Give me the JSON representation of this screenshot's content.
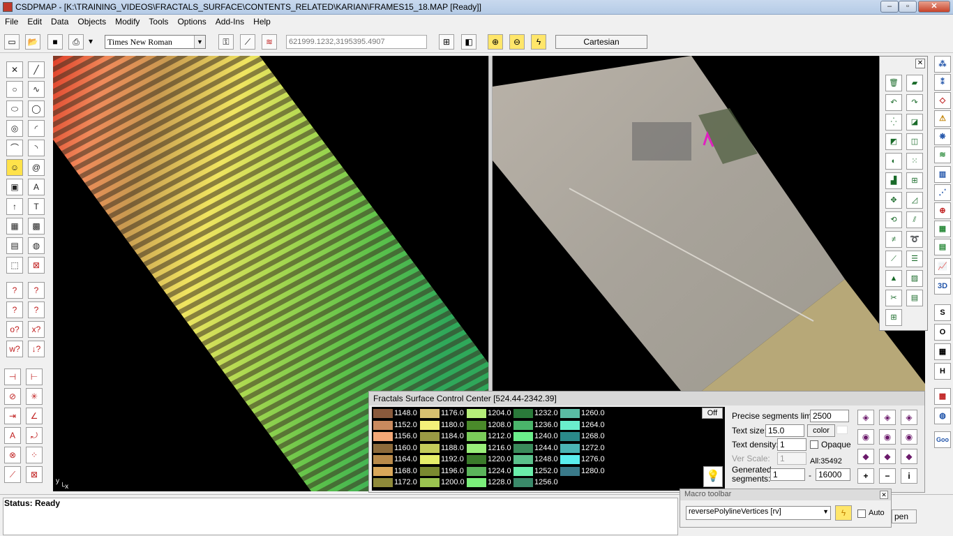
{
  "window": {
    "title": "CSDPMAP - [K:\\TRAINING_VIDEOS\\FRACTALS_SURFACE\\CONTENTS_RELATED\\KARIAN\\FRAMES15_18.MAP [Ready]]",
    "minimize": "–",
    "maximize": "▫",
    "close": "✕"
  },
  "menu": [
    "File",
    "Edit",
    "Data",
    "Objects",
    "Modify",
    "Tools",
    "Options",
    "Add-Ins",
    "Help"
  ],
  "toolbar": {
    "font": "Times New Roman",
    "coords": "621999.1232,3195395.4907",
    "mode": "Cartesian"
  },
  "viewport": {
    "axis_label": "y\n1x"
  },
  "fscc": {
    "title": "Fractals Surface Control Center [524.44-2342.39]",
    "off": "Off",
    "legend": [
      {
        "v": "1148.0",
        "c": "#8a5a3c"
      },
      {
        "v": "1152.0",
        "c": "#c98a5e"
      },
      {
        "v": "1156.0",
        "c": "#f3a877"
      },
      {
        "v": "1160.0",
        "c": "#8c6a3a"
      },
      {
        "v": "1164.0",
        "c": "#b88a4a"
      },
      {
        "v": "1168.0",
        "c": "#d9a85a"
      },
      {
        "v": "1172.0",
        "c": "#8f8a3a"
      },
      {
        "v": "1176.0",
        "c": "#d7c070"
      },
      {
        "v": "1180.0",
        "c": "#f4f07a"
      },
      {
        "v": "1184.0",
        "c": "#9a9a44"
      },
      {
        "v": "1188.0",
        "c": "#c4cc5a"
      },
      {
        "v": "1192.0",
        "c": "#e6ee6a"
      },
      {
        "v": "1196.0",
        "c": "#7a8a30"
      },
      {
        "v": "1200.0",
        "c": "#9ac450"
      },
      {
        "v": "1204.0",
        "c": "#b6ee7a"
      },
      {
        "v": "1208.0",
        "c": "#4a8a2a"
      },
      {
        "v": "1212.0",
        "c": "#7acc5a"
      },
      {
        "v": "1216.0",
        "c": "#9aee7a"
      },
      {
        "v": "1220.0",
        "c": "#3a7a2a"
      },
      {
        "v": "1224.0",
        "c": "#5ab45a"
      },
      {
        "v": "1228.0",
        "c": "#7aee7a"
      },
      {
        "v": "1232.0",
        "c": "#2a7a3a"
      },
      {
        "v": "1236.0",
        "c": "#4ab46a"
      },
      {
        "v": "1240.0",
        "c": "#6aee8a"
      },
      {
        "v": "1244.0",
        "c": "#3a8a5a"
      },
      {
        "v": "1248.0",
        "c": "#5ac08a"
      },
      {
        "v": "1252.0",
        "c": "#6aeeaa"
      },
      {
        "v": "1256.0",
        "c": "#3a8a6a"
      },
      {
        "v": "1260.0",
        "c": "#5abca4"
      },
      {
        "v": "1264.0",
        "c": "#6aeecc"
      },
      {
        "v": "1268.0",
        "c": "#2a8a8a"
      },
      {
        "v": "1272.0",
        "c": "#4ab4b4"
      },
      {
        "v": "1276.0",
        "c": "#5aeeee"
      },
      {
        "v": "1280.0",
        "c": "#3a7a8a"
      }
    ],
    "precise_label": "Precise segments limit:",
    "precise_value": "2500",
    "textsize_label": "Text size:",
    "textsize_value": "15.0",
    "color_label": "color",
    "density_label": "Text density:",
    "density_value": "1",
    "opaque_label": "Opaque",
    "verscale_label": "Ver Scale:",
    "verscale_value": "1",
    "all_label": "All:35492",
    "gen_label": "Generated segments:",
    "gen_from": "1",
    "gen_dash": "-",
    "gen_to": "16000",
    "plus": "+",
    "minus": "−",
    "info": "i"
  },
  "status": {
    "text": "Status: Ready"
  },
  "macro": {
    "title": "Macro toolbar",
    "value": "reversePolylineVertices [rv]",
    "auto": "Auto",
    "open": "pen"
  }
}
